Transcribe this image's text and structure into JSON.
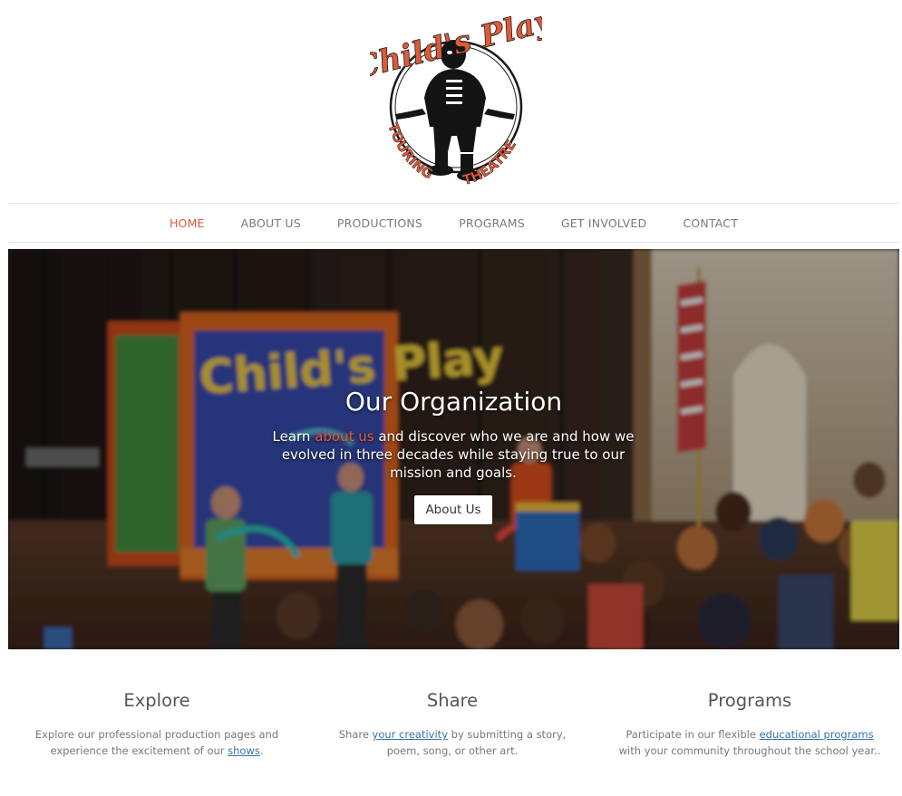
{
  "logo": {
    "script_text": "Child's Play",
    "arc_left": "TOURING",
    "arc_right": "THEATRE",
    "accent": "#e05a3a"
  },
  "nav": {
    "items": [
      {
        "label": "HOME",
        "active": true
      },
      {
        "label": "ABOUT US",
        "active": false
      },
      {
        "label": "PRODUCTIONS",
        "active": false
      },
      {
        "label": "PROGRAMS",
        "active": false
      },
      {
        "label": "GET INVOLVED",
        "active": false
      },
      {
        "label": "CONTACT",
        "active": false
      }
    ]
  },
  "hero": {
    "title": "Our Organization",
    "body_prefix": "Learn ",
    "body_link": "about us",
    "body_suffix": " and discover who we are and how we evolved in three decades while staying true to our mission and goals.",
    "button": "About Us",
    "sign_text": "Child's Play"
  },
  "features": [
    {
      "title": "Explore",
      "text_before": "Explore our professional production pages and experience the excitement of our ",
      "link": "shows",
      "text_after": "."
    },
    {
      "title": "Share",
      "text_before": "Share ",
      "link": "your creativity",
      "text_after": " by submitting a story, poem, song, or other art."
    },
    {
      "title": "Programs",
      "text_before": "Participate in our flexible ",
      "link": "educational programs",
      "text_after": " with your community throughout the school year.."
    }
  ],
  "colors": {
    "accent": "#e0573a",
    "link": "#3a73a8",
    "nav_text": "#7a7a7a"
  }
}
